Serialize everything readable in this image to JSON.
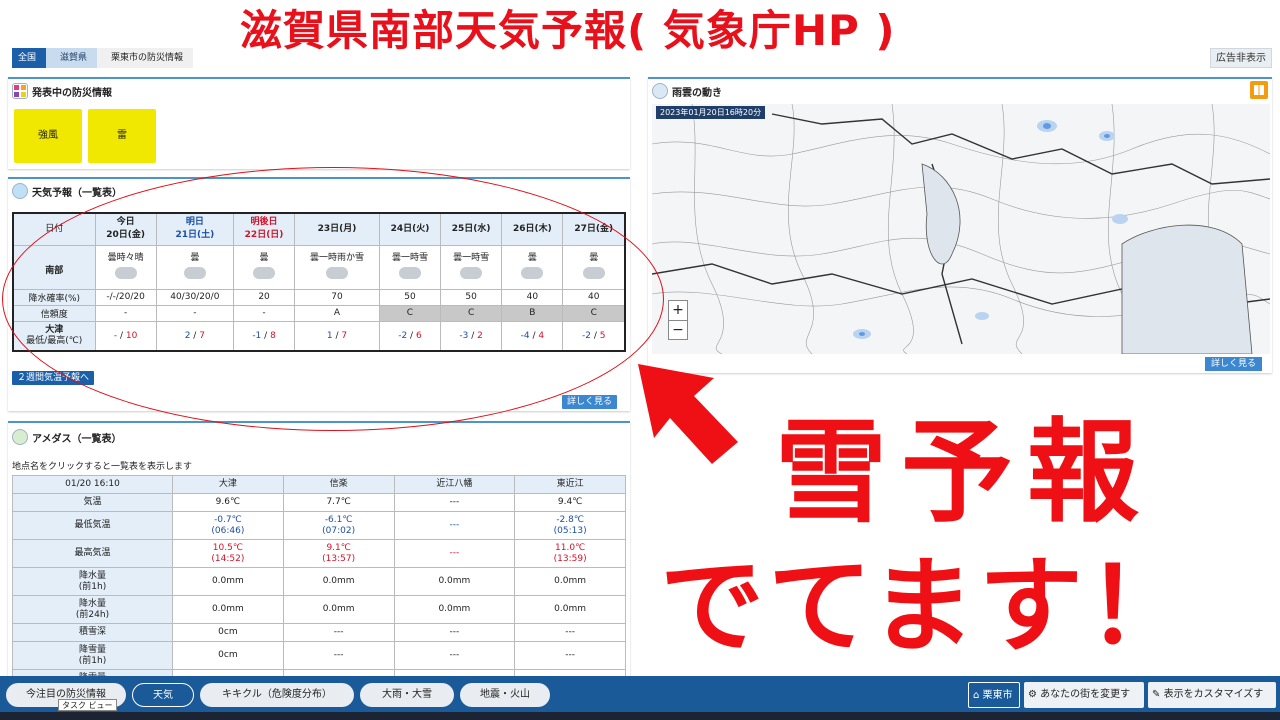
{
  "banner": {
    "title": "滋賀県南部天気予報( 気象庁HP )"
  },
  "breadcrumb": [
    "全国",
    "滋賀県",
    "栗東市の防災情報"
  ],
  "ad_hide": "広告非表示",
  "warnings": {
    "title": "発表中の防災情報",
    "items": [
      "強風",
      "雷"
    ]
  },
  "forecast": {
    "title": "天気予報（一覧表）",
    "date_header": "日付",
    "days": [
      {
        "label": "今日",
        "date": "20日(金)",
        "style": "normal",
        "weather": "曇時々晴",
        "pop": "-/-/20/20",
        "reliability": "-",
        "min": "-",
        "max": "10"
      },
      {
        "label": "明日",
        "date": "21日(土)",
        "style": "blue",
        "weather": "曇",
        "pop": "40/30/20/0",
        "reliability": "-",
        "min": "2",
        "max": "7"
      },
      {
        "label": "明後日",
        "date": "22日(日)",
        "style": "red",
        "weather": "曇",
        "pop": "20",
        "reliability": "-",
        "min": "-1",
        "max": "8"
      },
      {
        "label": "",
        "date": "23日(月)",
        "style": "normal",
        "weather": "曇一時雨か雪",
        "pop": "70",
        "reliability": "A",
        "min": "1",
        "max": "7"
      },
      {
        "label": "",
        "date": "24日(火)",
        "style": "normal",
        "weather": "曇一時雪",
        "pop": "50",
        "reliability": "C",
        "min": "-2",
        "max": "6"
      },
      {
        "label": "",
        "date": "25日(水)",
        "style": "normal",
        "weather": "曇一時雪",
        "pop": "50",
        "reliability": "C",
        "min": "-3",
        "max": "2"
      },
      {
        "label": "",
        "date": "26日(木)",
        "style": "normal",
        "weather": "曇",
        "pop": "40",
        "reliability": "B",
        "min": "-4",
        "max": "4"
      },
      {
        "label": "",
        "date": "27日(金)",
        "style": "normal",
        "weather": "曇",
        "pop": "40",
        "reliability": "C",
        "min": "-2",
        "max": "5"
      }
    ],
    "row_region": "南部",
    "row_pop": "降水確率(%)",
    "row_reliability": "信頼度",
    "row_temp_place": "大津",
    "row_temp_label": "最低/最高(℃)",
    "two_week_button": "２週間気温予報へ",
    "detail_button": "詳しく見る"
  },
  "amedas": {
    "title": "アメダス（一覧表）",
    "instruction": "地点名をクリックすると一覧表を表示します",
    "timestamp": "01/20 16:10",
    "stations": [
      "大津",
      "信楽",
      "近江八幡",
      "東近江"
    ],
    "rows": [
      {
        "label": "気温",
        "values": [
          "9.6℃",
          "7.7℃",
          "---",
          "9.4℃"
        ]
      },
      {
        "label": "最低気温",
        "values": [
          "-0.7℃\n(06:46)",
          "-6.1℃\n(07:02)",
          "---",
          "-2.8℃\n(05:13)"
        ],
        "color": "blue"
      },
      {
        "label": "最高気温",
        "values": [
          "10.5℃\n(14:52)",
          "9.1℃\n(13:57)",
          "---",
          "11.0℃\n(13:59)"
        ],
        "color": "red"
      },
      {
        "label": "降水量\n(前1h)",
        "values": [
          "0.0mm",
          "0.0mm",
          "0.0mm",
          "0.0mm"
        ]
      },
      {
        "label": "降水量\n(前24h)",
        "values": [
          "0.0mm",
          "0.0mm",
          "0.0mm",
          "0.0mm"
        ]
      },
      {
        "label": "積雪深",
        "values": [
          "0cm",
          "---",
          "---",
          "---"
        ]
      },
      {
        "label": "降雪量\n(前1h)",
        "values": [
          "0cm",
          "---",
          "---",
          "---"
        ]
      },
      {
        "label": "降雪量",
        "values": [
          "",
          "",
          "",
          ""
        ]
      }
    ]
  },
  "radar": {
    "title": "雨雲の動き",
    "timestamp": "2023年01月20日16時20分",
    "zoom_in": "+",
    "zoom_out": "−",
    "detail_button": "詳しく見る"
  },
  "annotation": {
    "line1": "雪予報",
    "line2": "でてます！"
  },
  "bottom_nav": {
    "items": [
      "今注目の防災情報",
      "天気",
      "キキクル（危険度分布）",
      "大雨・大雪",
      "地震・火山"
    ],
    "active_index": 1,
    "city_button": "栗東市",
    "change_city": "あなたの街を変更する",
    "customize": "表示をカスタマイズする",
    "tooltip": "タスク ビュー"
  },
  "colors": {
    "accent": "#1a5fa8",
    "warning": "#f0e800",
    "annotation_red": "#ee1014"
  }
}
